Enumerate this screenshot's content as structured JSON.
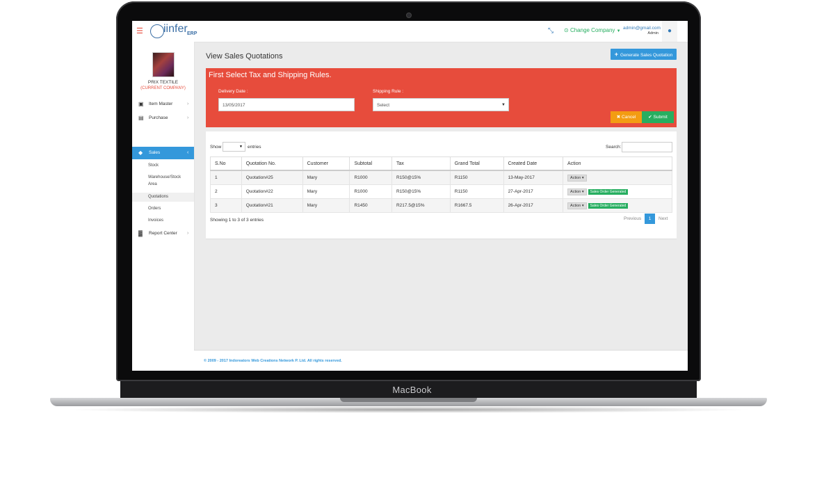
{
  "device": {
    "label": "MacBook"
  },
  "app": {
    "logo_text": "iinfer",
    "logo_suffix": "ERP",
    "change_company": "Change Company",
    "user_email": "admin@gmail.com",
    "user_role": "Admin"
  },
  "sidebar": {
    "company_name": "PRIX TEXTILE",
    "company_status": "(CURRENT COMPANY)",
    "items": [
      {
        "label": "Item Master",
        "icon": "gift-icon"
      },
      {
        "label": "Purchase",
        "icon": "cart-icon"
      },
      {
        "label": "Sales",
        "icon": "tag-icon"
      },
      {
        "label": "Report Center",
        "icon": "bar-chart-icon"
      }
    ],
    "sales_sub": [
      {
        "label": "Stock"
      },
      {
        "label": "Warehouse/Stock"
      },
      {
        "label": "Area"
      },
      {
        "label": "Quotations"
      },
      {
        "label": "Orders"
      },
      {
        "label": "Invoices"
      }
    ]
  },
  "page": {
    "title": "View Sales Quotations",
    "generate_button": "Generate Sales Quotation"
  },
  "rules": {
    "title": "First Select Tax and Shipping Rules.",
    "delivery_label": "Delivery Date :",
    "delivery_value": "13/05/2017",
    "shipping_label": "Shipping Rule :",
    "shipping_value": "Select",
    "cancel": "Cancel",
    "submit": "Submit"
  },
  "table": {
    "show_label": "Show",
    "entries_label": "entries",
    "search_label": "Search:",
    "columns": [
      "S.No",
      "Quotation No.",
      "Customer",
      "Subtotal",
      "Tax",
      "Grand Total",
      "Created Date",
      "Action"
    ],
    "rows": [
      {
        "sno": "1",
        "quotation": "Quotation#25",
        "customer": "Mary",
        "subtotal": "R1000",
        "tax": "R150@15%",
        "grand_total": "R1150",
        "date": "13-May-2017",
        "action": "Action",
        "badge": ""
      },
      {
        "sno": "2",
        "quotation": "Quotation#22",
        "customer": "Mary",
        "subtotal": "R1000",
        "tax": "R150@15%",
        "grand_total": "R1150",
        "date": "27-Apr-2017",
        "action": "Action",
        "badge": "Sales Order Generated"
      },
      {
        "sno": "3",
        "quotation": "Quotation#21",
        "customer": "Mary",
        "subtotal": "R1450",
        "tax": "R217.5@15%",
        "grand_total": "R1667.5",
        "date": "26-Apr-2017",
        "action": "Action",
        "badge": "Sales Order Generated"
      }
    ],
    "info": "Showing 1 to 3 of 3 entries",
    "prev": "Previous",
    "page": "1",
    "next": "Next"
  },
  "footer": {
    "text": "© 2009 - 2017 Indoreators Web Creations Network P. Ltd. All rights reserved."
  },
  "colors": {
    "primary": "#3498db",
    "danger": "#e74c3c",
    "success": "#27ae60",
    "warning": "#f39c12"
  }
}
